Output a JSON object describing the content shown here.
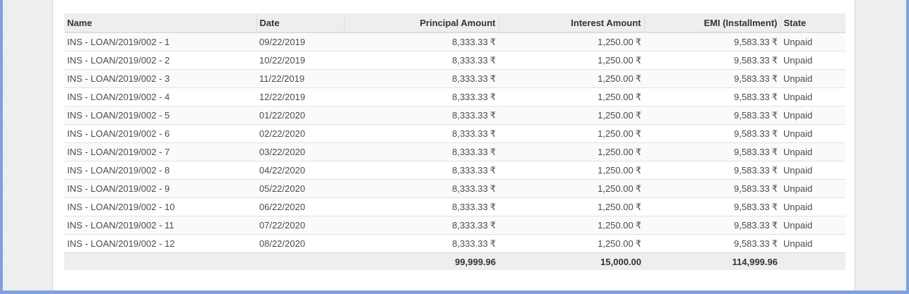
{
  "table": {
    "columns": [
      "Name",
      "Date",
      "Principal Amount",
      "Interest Amount",
      "EMI (Installment)",
      "State"
    ],
    "currency_symbol": "₹",
    "rows": [
      {
        "name": "INS - LOAN/2019/002 - 1",
        "date": "09/22/2019",
        "principal": "8,333.33",
        "interest": "1,250.00",
        "emi": "9,583.33",
        "state": "Unpaid"
      },
      {
        "name": "INS - LOAN/2019/002 - 2",
        "date": "10/22/2019",
        "principal": "8,333.33",
        "interest": "1,250.00",
        "emi": "9,583.33",
        "state": "Unpaid"
      },
      {
        "name": "INS - LOAN/2019/002 - 3",
        "date": "11/22/2019",
        "principal": "8,333.33",
        "interest": "1,250.00",
        "emi": "9,583.33",
        "state": "Unpaid"
      },
      {
        "name": "INS - LOAN/2019/002 - 4",
        "date": "12/22/2019",
        "principal": "8,333.33",
        "interest": "1,250.00",
        "emi": "9,583.33",
        "state": "Unpaid"
      },
      {
        "name": "INS - LOAN/2019/002 - 5",
        "date": "01/22/2020",
        "principal": "8,333.33",
        "interest": "1,250.00",
        "emi": "9,583.33",
        "state": "Unpaid"
      },
      {
        "name": "INS - LOAN/2019/002 - 6",
        "date": "02/22/2020",
        "principal": "8,333.33",
        "interest": "1,250.00",
        "emi": "9,583.33",
        "state": "Unpaid"
      },
      {
        "name": "INS - LOAN/2019/002 - 7",
        "date": "03/22/2020",
        "principal": "8,333.33",
        "interest": "1,250.00",
        "emi": "9,583.33",
        "state": "Unpaid"
      },
      {
        "name": "INS - LOAN/2019/002 - 8",
        "date": "04/22/2020",
        "principal": "8,333.33",
        "interest": "1,250.00",
        "emi": "9,583.33",
        "state": "Unpaid"
      },
      {
        "name": "INS - LOAN/2019/002 - 9",
        "date": "05/22/2020",
        "principal": "8,333.33",
        "interest": "1,250.00",
        "emi": "9,583.33",
        "state": "Unpaid"
      },
      {
        "name": "INS - LOAN/2019/002 - 10",
        "date": "06/22/2020",
        "principal": "8,333.33",
        "interest": "1,250.00",
        "emi": "9,583.33",
        "state": "Unpaid"
      },
      {
        "name": "INS - LOAN/2019/002 - 11",
        "date": "07/22/2020",
        "principal": "8,333.33",
        "interest": "1,250.00",
        "emi": "9,583.33",
        "state": "Unpaid"
      },
      {
        "name": "INS - LOAN/2019/002 - 12",
        "date": "08/22/2020",
        "principal": "8,333.33",
        "interest": "1,250.00",
        "emi": "9,583.33",
        "state": "Unpaid"
      }
    ],
    "totals": {
      "principal": "99,999.96",
      "interest": "15,000.00",
      "emi": "114,999.96"
    }
  }
}
